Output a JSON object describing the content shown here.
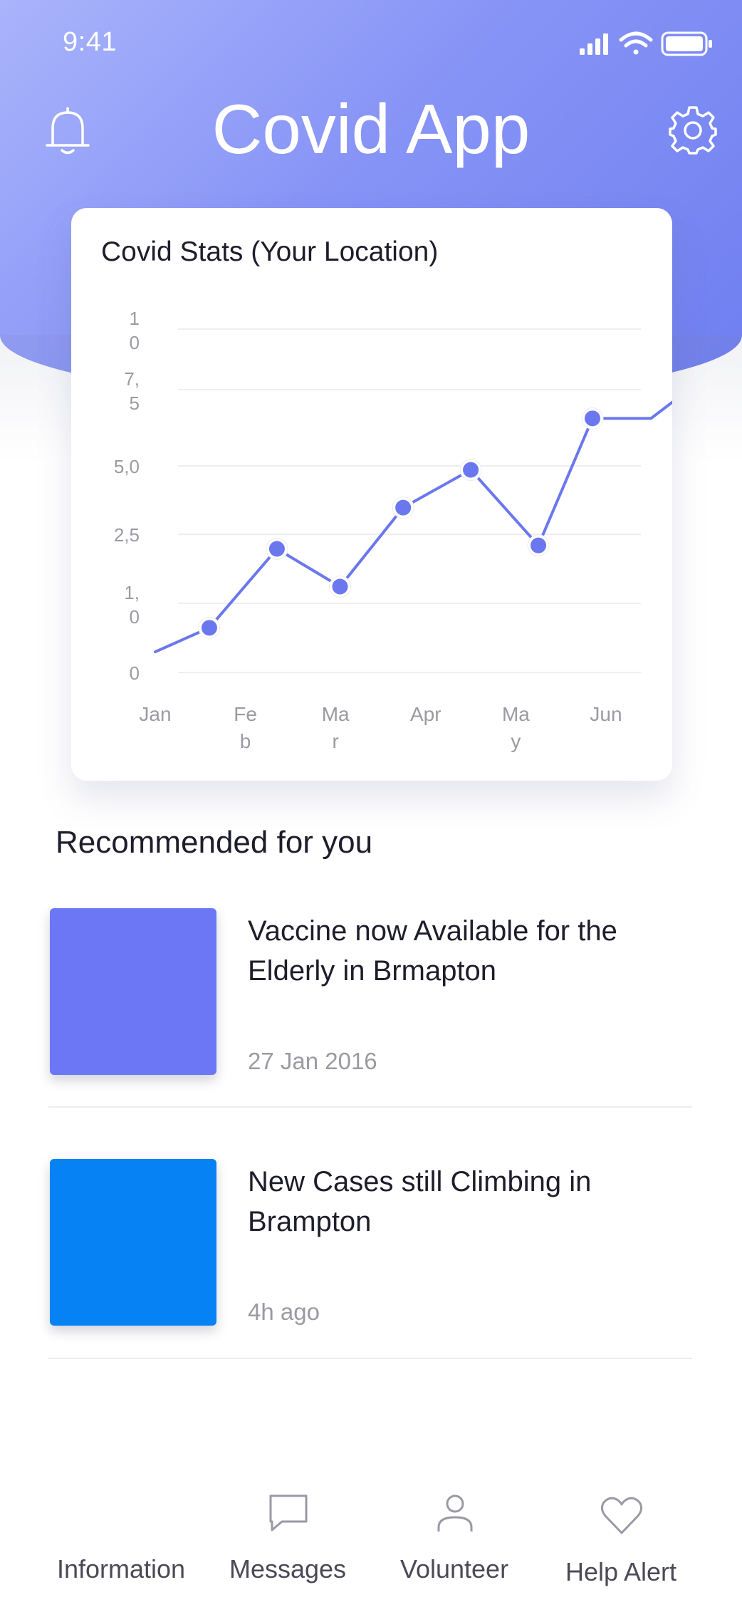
{
  "status_bar": {
    "time": "9:41"
  },
  "header": {
    "title": "Covid App"
  },
  "stats_card": {
    "title": "Covid Stats (Your Location)"
  },
  "chart_data": {
    "type": "line",
    "title": "Covid Stats (Your Location)",
    "categories": [
      "Jan",
      "Feb",
      "Mar",
      "Apr",
      "May",
      "Jun"
    ],
    "x_tick_labels": [
      [
        "Jan"
      ],
      [
        "Fe",
        "b"
      ],
      [
        "Ma",
        "r"
      ],
      [
        "Apr"
      ],
      [
        "Ma",
        "y"
      ],
      [
        "Jun"
      ]
    ],
    "y_tick_labels": [
      [
        "1",
        "0"
      ],
      [
        "7,",
        "5"
      ],
      [
        "5,0"
      ],
      [
        "2,5"
      ],
      [
        "1,",
        "0"
      ],
      [
        "0"
      ]
    ],
    "series": [
      {
        "x": [
          0.0,
          0.6,
          1.35,
          2.05,
          2.75,
          3.5,
          4.25,
          4.85,
          5.5,
          5.85
        ],
        "values": [
          0.6,
          1.3,
          3.6,
          2.5,
          4.8,
          5.9,
          3.7,
          7.4,
          7.4,
          8.1
        ],
        "marker_indices": [
          1,
          2,
          3,
          4,
          5,
          6,
          7
        ]
      }
    ],
    "ylim": [
      0,
      10
    ],
    "grid": true,
    "line_color": "#6b77ee"
  },
  "recommended": {
    "title": "Recommended for you",
    "items": [
      {
        "title": "Vaccine now Available for the Elderly in Brmapton",
        "meta": "27 Jan 2016",
        "thumb_color": "#6b77f5"
      },
      {
        "title": "New Cases still Climbing in Brampton",
        "meta": "4h ago",
        "thumb_color": "#0682f5"
      }
    ]
  },
  "tabbar": {
    "items": [
      {
        "label": "Information",
        "icon": "info-icon"
      },
      {
        "label": "Messages",
        "icon": "message-icon"
      },
      {
        "label": "Volunteer",
        "icon": "user-icon"
      },
      {
        "label": "Help Alert",
        "icon": "heart-icon"
      }
    ]
  },
  "colors": {
    "accent": "#6b77ee",
    "header_start": "#a9b4fb",
    "header_end": "#6f7ef0"
  }
}
